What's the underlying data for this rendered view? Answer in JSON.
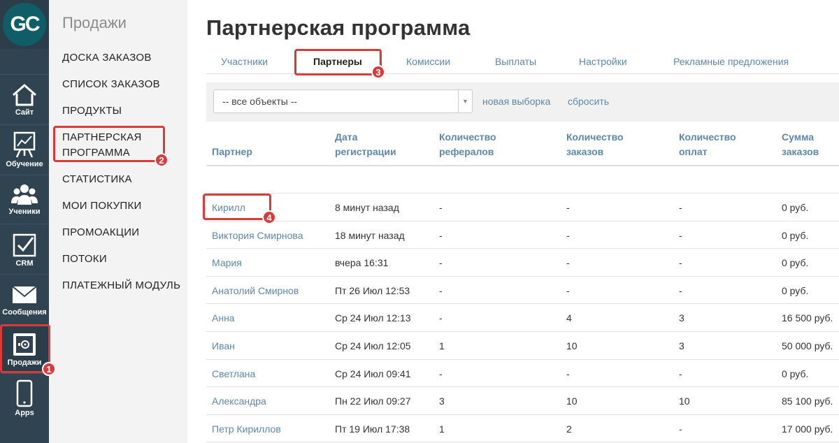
{
  "rail": {
    "logo": "GC",
    "items": [
      {
        "label": "Сайт",
        "icon": "house-icon"
      },
      {
        "label": "Обучение",
        "icon": "presentation-board-icon"
      },
      {
        "label": "Ученики",
        "icon": "users-icon"
      },
      {
        "label": "CRM",
        "icon": "checkbox-icon"
      },
      {
        "label": "Сообщения",
        "icon": "envelope-icon"
      },
      {
        "label": "Продажи",
        "icon": "safe-icon"
      },
      {
        "label": "Apps",
        "icon": "smartphone-icon"
      }
    ]
  },
  "menu": {
    "title": "Продажи",
    "items": [
      "ДОСКА ЗАКАЗОВ",
      "СПИСОК ЗАКАЗОВ",
      "ПРОДУКТЫ",
      "ПАРТНЕРСКАЯ ПРОГРАММА",
      "СТАТИСТИКА",
      "МОИ ПОКУПКИ",
      "ПРОМОАКЦИИ",
      "ПОТОКИ",
      "ПЛАТЕЖНЫЙ МОДУЛЬ"
    ]
  },
  "page": {
    "title": "Партнерская программа",
    "tabs": [
      "Участники",
      "Партнеры",
      "Комиссии",
      "Выплаты",
      "Настройки",
      "Рекламные предложения"
    ],
    "active_tab": "Партнеры"
  },
  "filter": {
    "select_value": "-- все объекты --",
    "new_selection": "новая выборка",
    "reset": "сбросить"
  },
  "table": {
    "headers": [
      [
        "Партнер"
      ],
      [
        "Дата",
        "регистрации"
      ],
      [
        "Количество",
        "рефералов"
      ],
      [
        "Количество",
        "заказов"
      ],
      [
        "Количество",
        "оплат"
      ],
      [
        "Сумма",
        "заказов"
      ]
    ],
    "rows": [
      [
        "Кирилл",
        "8 минут назад",
        "-",
        "-",
        "-",
        "0 руб."
      ],
      [
        "Виктория Смирнова",
        "18 минут назад",
        "-",
        "-",
        "-",
        "0 руб."
      ],
      [
        "Мария",
        "вчера 16:31",
        "-",
        "-",
        "-",
        "0 руб."
      ],
      [
        "Анатолий Смирнов",
        "Пт 26 Июл 12:53",
        "-",
        "-",
        "-",
        "0 руб."
      ],
      [
        "Анна",
        "Ср 24 Июл 12:13",
        "-",
        "4",
        "3",
        "16 500 руб."
      ],
      [
        "Иван",
        "Ср 24 Июл 12:05",
        "1",
        "10",
        "3",
        "50 000 руб."
      ],
      [
        "Светлана",
        "Ср 24 Июл 09:41",
        "-",
        "-",
        "-",
        "0 руб."
      ],
      [
        "Александра",
        "Пн 22 Июл 09:27",
        "3",
        "10",
        "10",
        "85 100 руб."
      ],
      [
        "Петр Кириллов",
        "Пт 19 Июл 17:38",
        "1",
        "2",
        "-",
        "17 000 руб."
      ]
    ]
  },
  "annotations": {
    "badges": [
      "1",
      "2",
      "3",
      "4"
    ],
    "color": "#d93a3a"
  },
  "colors": {
    "rail_bg": "#2f4350",
    "logo_bg": "#0f5d66",
    "link": "#5e87a8"
  }
}
